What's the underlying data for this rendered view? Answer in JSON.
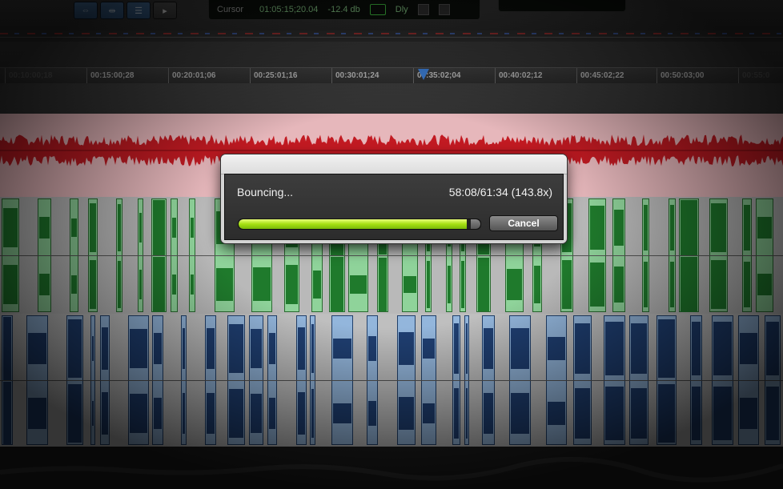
{
  "counter": {
    "label": "Cursor",
    "timecode": "01:05:15;20.04",
    "level": "-12.4 db",
    "delay_label": "Dly"
  },
  "ruler": {
    "ticks": [
      "00:10:00;18",
      "00:15:00;28",
      "00:20:01;06",
      "00:25:01;16",
      "00:30:01;24",
      "00:35:02;04",
      "00:40:02;12",
      "00:45:02;22",
      "00:50:03;00",
      "00:55:0"
    ]
  },
  "dialog": {
    "status": "Bouncing...",
    "time": "58:08/61:34 (143.8x)",
    "progress": 0.944,
    "cancel_label": "Cancel"
  },
  "colors": {
    "red_track": "#e6b7bb",
    "green_track": "#8fd39a",
    "blue_track": "#93b6dc",
    "progress": "#a6e012"
  }
}
